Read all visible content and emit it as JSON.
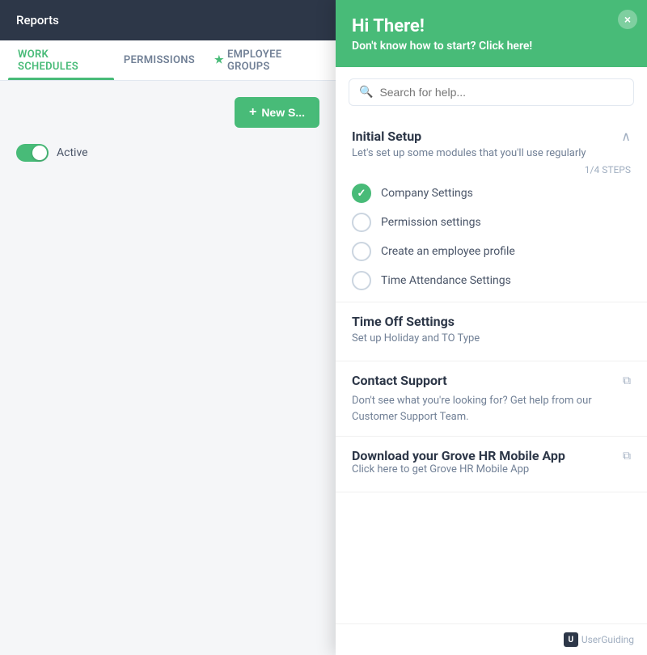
{
  "header": {
    "title": "Reports"
  },
  "tabs": [
    {
      "id": "work-schedules",
      "label": "WORK SCHEDULES",
      "active": true,
      "star": false
    },
    {
      "id": "permissions",
      "label": "PERMISSIONS",
      "active": false,
      "star": false
    },
    {
      "id": "employee-groups",
      "label": "EMPLOYEE GROUPS",
      "active": false,
      "star": true
    }
  ],
  "main": {
    "new_button_label": "New S...",
    "new_button_plus": "+",
    "active_label": "Active"
  },
  "help": {
    "title": "Hi There!",
    "subtitle": "Don't know how to start? Click here!",
    "close_label": "×",
    "search_placeholder": "Search for help...",
    "initial_setup": {
      "title": "Initial Setup",
      "description": "Let's set up some modules that you'll use regularly",
      "steps_count": "1/4 STEPS",
      "chevron": "^",
      "items": [
        {
          "label": "Company Settings",
          "completed": true
        },
        {
          "label": "Permission settings",
          "completed": false
        },
        {
          "label": "Create an employee profile",
          "completed": false
        },
        {
          "label": "Time Attendance Settings",
          "completed": false
        }
      ]
    },
    "time_off": {
      "title": "Time Off Settings",
      "description": "Set up Holiday and TO Type"
    },
    "contact_support": {
      "title": "Contact Support",
      "description": "Don't see what you're looking for? Get help from our Customer Support Team.",
      "external_icon": "⧉"
    },
    "mobile_app": {
      "title": "Download your Grove HR Mobile App",
      "description": "Click here to get Grove HR Mobile App",
      "external_icon": "⧉"
    }
  },
  "footer": {
    "userguiding_label": "UserGuiding"
  }
}
